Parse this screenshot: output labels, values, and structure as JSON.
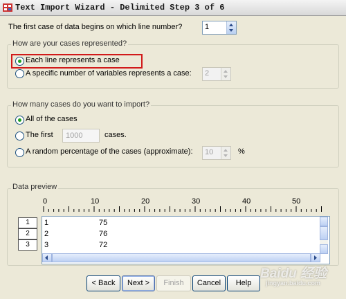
{
  "window": {
    "title": "Text Import Wizard - Delimited Step 3 of 6"
  },
  "first_case": {
    "label": "The first case of data begins on which line number?",
    "value": "1"
  },
  "represent_group": {
    "legend": "How are your cases represented?",
    "option_each_line": "Each line represents a case",
    "option_specific": "A specific number of variables represents a case:",
    "specific_value": "2",
    "selected": "each_line"
  },
  "import_group": {
    "legend": "How many cases do you want to import?",
    "option_all": "All of the cases",
    "option_first": "The first",
    "first_value": "1000",
    "first_suffix": "cases.",
    "option_random": "A random percentage of the cases (approximate):",
    "random_value": "10",
    "random_suffix": "%",
    "selected": "all"
  },
  "preview": {
    "legend": "Data preview",
    "ruler": [
      "0",
      "10",
      "20",
      "30",
      "40",
      "50"
    ],
    "rows": [
      {
        "num": "1",
        "c1": "1",
        "c2": "75"
      },
      {
        "num": "2",
        "c1": "2",
        "c2": "76"
      },
      {
        "num": "3",
        "c1": "3",
        "c2": "72"
      }
    ]
  },
  "buttons": {
    "back": "< Back",
    "next": "Next >",
    "finish": "Finish",
    "cancel": "Cancel",
    "help": "Help"
  },
  "watermark": {
    "text": "Baidu 经验",
    "sub": "jingyan.baidu.com"
  }
}
